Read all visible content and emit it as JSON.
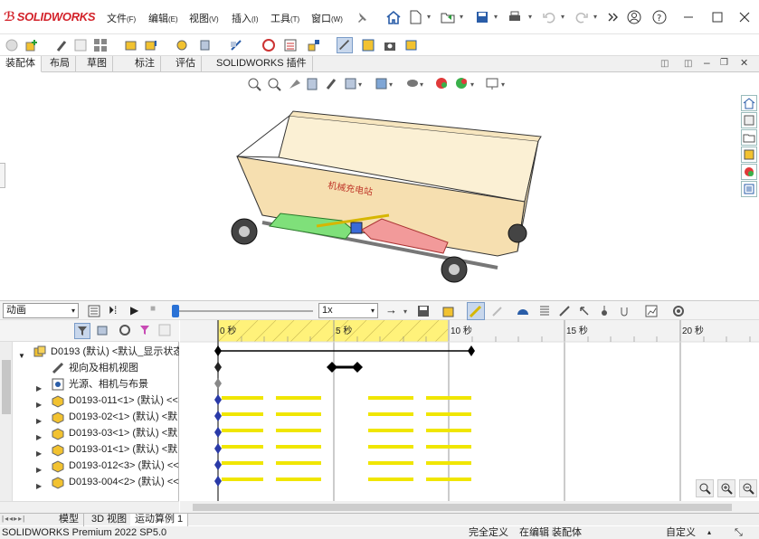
{
  "app": {
    "logo": "SOLIDWORKS"
  },
  "menu": [
    {
      "label": "文件",
      "key": "(F)"
    },
    {
      "label": "编辑",
      "key": "(E)"
    },
    {
      "label": "视图",
      "key": "(V)"
    },
    {
      "label": "插入",
      "key": "(I)"
    },
    {
      "label": "工具",
      "key": "(T)"
    },
    {
      "label": "窗口",
      "key": "(W)"
    }
  ],
  "command_tabs": [
    "装配体",
    "布局",
    "草图",
    "标注",
    "评估",
    "SOLIDWORKS 插件"
  ],
  "model": {
    "watermark": "机械充电站"
  },
  "motion": {
    "study_type": "动画",
    "speed": "1x"
  },
  "tree": [
    {
      "label": "D0193 (默认) <默认_显示状态",
      "icon": "assembly-icon",
      "expanded": true,
      "level": 0
    },
    {
      "label": "视向及相机视图",
      "icon": "camera-views-icon",
      "level": 1
    },
    {
      "label": "光源、相机与布景",
      "icon": "lights-icon",
      "level": 1
    },
    {
      "label": "D0193-011<1> (默认) <<",
      "icon": "part-icon",
      "level": 1
    },
    {
      "label": "D0193-02<1> (默认) <默",
      "icon": "part-icon",
      "level": 1
    },
    {
      "label": "D0193-03<1> (默认) <默",
      "icon": "part-icon",
      "level": 1
    },
    {
      "label": "D0193-01<1> (默认) <默",
      "icon": "part-icon",
      "level": 1
    },
    {
      "label": "D0193-012<3> (默认) <<",
      "icon": "part-icon",
      "level": 1
    },
    {
      "label": "D0193-004<2> (默认) <<",
      "icon": "part-icon",
      "level": 1
    }
  ],
  "timeline": {
    "ticks": [
      "0 秒",
      "5 秒",
      "10 秒",
      "15 秒",
      "20 秒"
    ]
  },
  "bottom_tabs": [
    "模型",
    "3D 视图",
    "运动算例 1"
  ],
  "status": {
    "product": "SOLIDWORKS Premium 2022 SP5.0",
    "state": "完全定义",
    "mode": "在编辑 装配体",
    "units": "自定义"
  }
}
